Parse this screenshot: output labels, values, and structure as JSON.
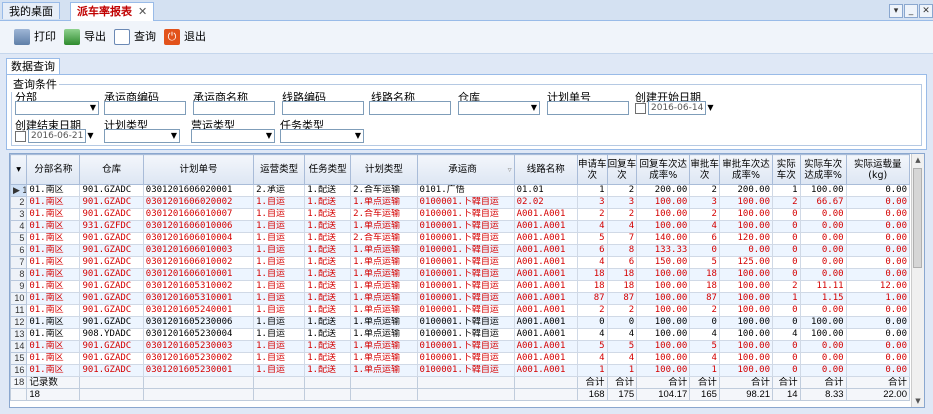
{
  "tabs": [
    {
      "label": "我的桌面",
      "active": false
    },
    {
      "label": "派车率报表",
      "active": true
    }
  ],
  "window_buttons": [
    "▾",
    "_",
    "✕"
  ],
  "toolbar": {
    "print": "打印",
    "export": "导出",
    "query": "查询",
    "exit": "退出"
  },
  "panel_title": "数据查询",
  "filter_legend": "查询条件",
  "filters": {
    "branch": "分部",
    "carrier_code": "承运商编码",
    "carrier_name": "承运商名称",
    "route_code": "线路编码",
    "route_name": "线路名称",
    "warehouse": "仓库",
    "plan_no": "计划单号",
    "create_start": "创建开始日期",
    "create_start_value": "2016-06-14",
    "create_end": "创建结束日期",
    "create_end_value": "2016-06-21",
    "plan_type": "计划类型",
    "ops_type": "营运类型",
    "task_type": "任务类型"
  },
  "columns": [
    "分部名称",
    "仓库",
    "计划单号",
    "运营类型",
    "任务类型",
    "计划类型",
    "承运商",
    "线路名称",
    "申请车次",
    "回复车次",
    "回复车次达成率%",
    "审批车次",
    "审批车次达成率%",
    "实际车次",
    "实际车次达成率%",
    "实际运载量(kg)"
  ],
  "rows": [
    [
      "01.南区",
      "901.GZADC",
      "0301201606020001",
      "2.承运",
      "1.配送",
      "2.合车运输",
      "0101.广悟",
      "01.01",
      "1",
      "2",
      "200.00",
      "2",
      "200.00",
      "1",
      "100.00",
      "0.00"
    ],
    [
      "01.南区",
      "901.GZADC",
      "0301201606020002",
      "1.自运",
      "1.配送",
      "1.单点运输",
      "0100001.卜韓自运",
      "02.02",
      "3",
      "3",
      "100.00",
      "3",
      "100.00",
      "2",
      "66.67",
      "0.00"
    ],
    [
      "01.南区",
      "901.GZADC",
      "0301201606010007",
      "1.自运",
      "1.配送",
      "2.合车运输",
      "0100001.卜韓自运",
      "A001.A001",
      "2",
      "2",
      "100.00",
      "2",
      "100.00",
      "0",
      "0.00",
      "0.00"
    ],
    [
      "01.南区",
      "931.GZFDC",
      "0301201606010006",
      "1.自运",
      "1.配送",
      "1.单点运输",
      "0100001.卜韓自运",
      "A001.A001",
      "4",
      "4",
      "100.00",
      "4",
      "100.00",
      "0",
      "0.00",
      "0.00"
    ],
    [
      "01.南区",
      "901.GZADC",
      "0301201606010004",
      "1.自运",
      "1.配送",
      "2.合车运输",
      "0100001.卜韓自运",
      "A001.A001",
      "5",
      "7",
      "140.00",
      "6",
      "120.00",
      "0",
      "0.00",
      "0.00"
    ],
    [
      "01.南区",
      "901.GZADC",
      "0301201606010003",
      "1.自运",
      "1.配送",
      "1.单点运输",
      "0100001.卜韓自运",
      "A001.A001",
      "6",
      "8",
      "133.33",
      "0",
      "0.00",
      "0",
      "0.00",
      "0.00"
    ],
    [
      "01.南区",
      "901.GZADC",
      "0301201606010002",
      "1.自运",
      "1.配送",
      "1.单点运输",
      "0100001.卜韓自运",
      "A001.A001",
      "4",
      "6",
      "150.00",
      "5",
      "125.00",
      "0",
      "0.00",
      "0.00"
    ],
    [
      "01.南区",
      "901.GZADC",
      "0301201606010001",
      "1.自运",
      "1.配送",
      "1.单点运输",
      "0100001.卜韓自运",
      "A001.A001",
      "18",
      "18",
      "100.00",
      "18",
      "100.00",
      "0",
      "0.00",
      "0.00"
    ],
    [
      "01.南区",
      "901.GZADC",
      "0301201605310002",
      "1.自运",
      "1.配送",
      "1.单点运输",
      "0100001.卜韓自运",
      "A001.A001",
      "18",
      "18",
      "100.00",
      "18",
      "100.00",
      "2",
      "11.11",
      "12.00"
    ],
    [
      "01.南区",
      "901.GZADC",
      "0301201605310001",
      "1.自运",
      "1.配送",
      "1.单点运输",
      "0100001.卜韓自运",
      "A001.A001",
      "87",
      "87",
      "100.00",
      "87",
      "100.00",
      "1",
      "1.15",
      "1.00"
    ],
    [
      "01.南区",
      "901.GZADC",
      "0301201605240001",
      "1.自运",
      "1.配送",
      "1.单点运输",
      "0100001.卜韓自运",
      "A001.A001",
      "2",
      "2",
      "100.00",
      "2",
      "100.00",
      "0",
      "0.00",
      "0.00"
    ],
    [
      "01.南区",
      "901.GZADC",
      "0301201605230006",
      "1.自运",
      "1.配送",
      "1.单点运输",
      "0100001.卜韓自运",
      "A001.A001",
      "0",
      "0",
      "100.00",
      "0",
      "100.00",
      "0",
      "100.00",
      "0.00"
    ],
    [
      "01.南区",
      "908.YDADC",
      "0301201605230004",
      "1.自运",
      "1.配送",
      "1.单点运输",
      "0100001.卜韓自运",
      "A001.A001",
      "4",
      "4",
      "100.00",
      "4",
      "100.00",
      "4",
      "100.00",
      "0.00"
    ],
    [
      "01.南区",
      "901.GZADC",
      "0301201605230003",
      "1.自运",
      "1.配送",
      "1.单点运输",
      "0100001.卜韓自运",
      "A001.A001",
      "5",
      "5",
      "100.00",
      "5",
      "100.00",
      "0",
      "0.00",
      "0.00"
    ],
    [
      "01.南区",
      "901.GZADC",
      "0301201605230002",
      "1.自运",
      "1.配送",
      "1.单点运输",
      "0100001.卜韓自运",
      "A001.A001",
      "4",
      "4",
      "100.00",
      "4",
      "100.00",
      "0",
      "0.00",
      "0.00"
    ],
    [
      "01.南区",
      "901.GZADC",
      "0301201605230001",
      "1.自运",
      "1.配送",
      "1.单点运输",
      "0100001.卜韓自运",
      "A001.A001",
      "1",
      "1",
      "100.00",
      "1",
      "100.00",
      "0",
      "0.00",
      "0.00"
    ]
  ],
  "row_colors": [
    "black",
    "red",
    "red",
    "red",
    "red",
    "red",
    "red",
    "red",
    "red",
    "red",
    "red",
    "black",
    "black",
    "red",
    "red",
    "red"
  ],
  "footer": {
    "row_number": "18",
    "count_label": "记录数",
    "count_value": "18",
    "sum_label": "合计",
    "sums": [
      "168",
      "175",
      "104.17",
      "165",
      "98.21",
      "14",
      "8.33",
      "22.00"
    ]
  }
}
